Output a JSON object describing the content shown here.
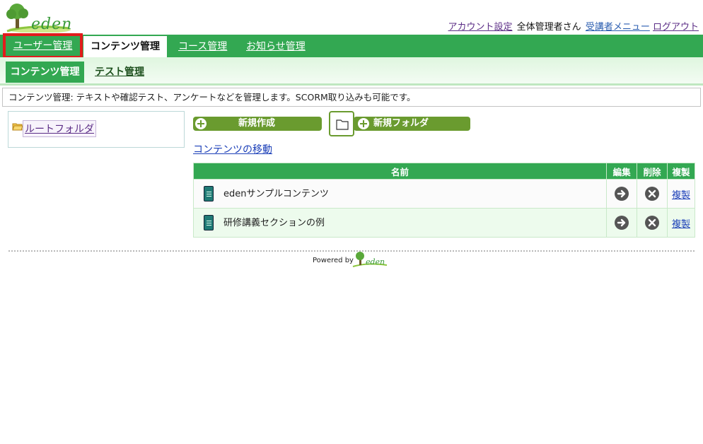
{
  "brand": {
    "logo_text": "eden"
  },
  "top_links": {
    "account_settings": "アカウント設定",
    "user_name": "全体管理者さん",
    "learner_menu": "受講者メニュー",
    "logout": "ログアウト"
  },
  "main_nav": {
    "user_mgmt": "ユーザー管理",
    "content_mgmt": "コンテンツ管理",
    "course_mgmt": "コース管理",
    "notice_mgmt": "お知らせ管理"
  },
  "sub_nav": {
    "content_mgmt": "コンテンツ管理",
    "test_mgmt": "テスト管理"
  },
  "description": "コンテンツ管理: テキストや確認テスト、アンケートなどを管理します。SCORM取り込みも可能です。",
  "tree": {
    "root_folder": "ルートフォルダ"
  },
  "actions": {
    "new_create": "新規作成",
    "new_folder": "新規フォルダ",
    "move_contents": "コンテンツの移動"
  },
  "table": {
    "headers": {
      "name": "名前",
      "edit": "編集",
      "delete": "削除",
      "duplicate": "複製"
    },
    "rows": [
      {
        "name": "edenサンプルコンテンツ",
        "duplicate": "複製"
      },
      {
        "name": "研修講義セクションの例",
        "duplicate": "複製"
      }
    ]
  },
  "footer": {
    "powered_by": "Powered by",
    "logo_text": "eden"
  },
  "colors": {
    "nav_green": "#33a852",
    "button_green": "#6a9b2f",
    "highlight_red": "#e21c1c"
  }
}
